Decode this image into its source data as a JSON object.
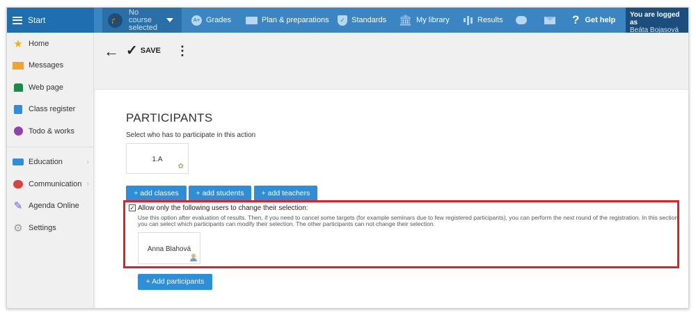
{
  "topbar": {
    "start_label": "Start",
    "course_label": "No course selected",
    "nav": {
      "grades": "Grades",
      "plan": "Plan & preparations",
      "standards": "Standards",
      "library": "My library",
      "results": "Results",
      "help": "Get help"
    },
    "logged_in_line1": "You are logged as",
    "logged_in_user": "Beáta Bojasová",
    "colors": {
      "bar": "#3a85c2",
      "start_bg": "#1f6fb0",
      "account_bg": "#1b4e7d"
    }
  },
  "sidebar": {
    "items": [
      {
        "label": "Home",
        "icon": "star-icon"
      },
      {
        "label": "Messages",
        "icon": "envelope-icon"
      },
      {
        "label": "Web page",
        "icon": "house-icon"
      },
      {
        "label": "Class register",
        "icon": "register-icon"
      },
      {
        "label": "Todo & works",
        "icon": "clock-icon"
      }
    ],
    "items2": [
      {
        "label": "Education",
        "icon": "book-icon"
      },
      {
        "label": "Communication",
        "icon": "people-icon"
      },
      {
        "label": "Agenda Online",
        "icon": "pen-icon"
      },
      {
        "label": "Settings",
        "icon": "gear-icon"
      }
    ]
  },
  "toolbar": {
    "save_label": "SAVE"
  },
  "main": {
    "heading": "PARTICIPANTS",
    "subtitle": "Select who has to participate in this action",
    "class_card": "1.A",
    "buttons": {
      "add_classes": "+ add classes",
      "add_students": "+ add students",
      "add_teachers": "+ add teachers"
    },
    "allow_label": "Allow only the following users to change their selection:",
    "allow_checked": true,
    "allow_desc": "Use this option after evaluation of results. Then, if you need to cancel some targets (for example seminars due to few registered participants), you can perform the next round of the registration. In this section, you can select which participants can modify their selection. The other participants can not change their selection.",
    "user_card": "Anna Blahová",
    "add_participants": "+ Add participants",
    "colors": {
      "button": "#2e8ed7",
      "highlight_box": "#e0202a"
    }
  }
}
